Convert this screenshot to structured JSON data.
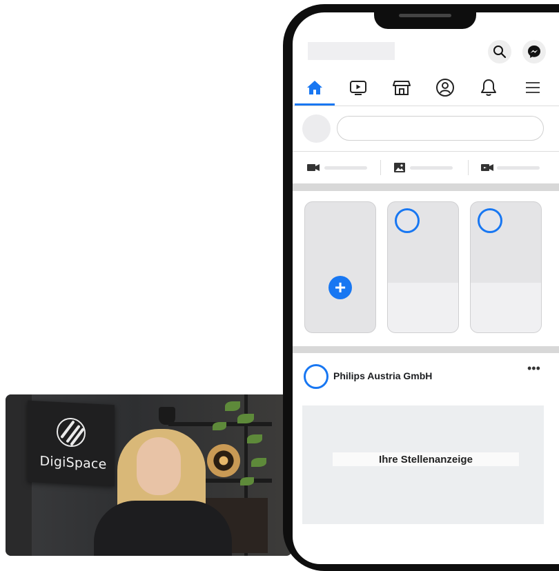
{
  "overlay": {
    "brand": "DigiSpace"
  },
  "phone": {
    "post": {
      "page_name": "Philips Austria GmbH",
      "more_icon": "•••",
      "ad_label": "Ihre Stellenanzeige"
    },
    "icons": {
      "search": "search-icon",
      "messenger": "messenger-icon",
      "home": "home-icon",
      "watch": "video-icon",
      "marketplace": "store-icon",
      "profile": "profile-icon",
      "notifications": "bell-icon",
      "menu": "hamburger-menu-icon"
    },
    "colors": {
      "accent": "#1877f2",
      "frame": "#0e0e0e"
    }
  }
}
